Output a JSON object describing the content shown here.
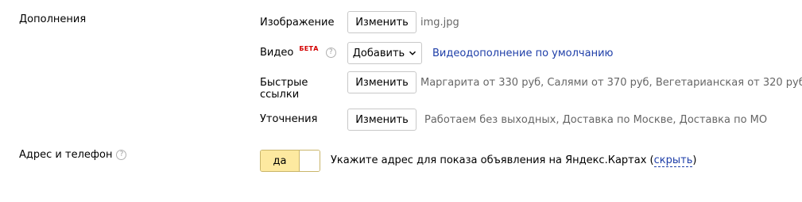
{
  "sections": {
    "extras_title": "Дополнения",
    "address_title": "Адрес и телефон",
    "address_help_icon": "question-circle-icon"
  },
  "image_row": {
    "label": "Изображение",
    "button": "Изменить",
    "value": "img.jpg"
  },
  "video_row": {
    "label": "Видео",
    "badge": "БЕТА",
    "help_icon": "question-circle-icon",
    "button": "Добавить",
    "button_icon": "chevron-down-icon",
    "link": "Видеодополнение по умолчанию"
  },
  "quick_links_row": {
    "label_line1": "Быстрые",
    "label_line2": "ссылки",
    "button": "Изменить",
    "value": "Маргарита от 330 руб, Салями от 370 руб, Вегетарианская от 320 руб"
  },
  "clarifications_row": {
    "label": "Уточнения",
    "button": "Изменить",
    "value": "Работаем без выходных, Доставка по Москве, Доставка по МО"
  },
  "address_row": {
    "toggle_label": "да",
    "text": "Укажите адрес для показа объявления на Яндекс.Картах (",
    "link": "скрыть",
    "text_end": ")"
  },
  "colors": {
    "link": "#1e3ea8",
    "beta": "#d40000",
    "toggle_on": "#fde9a0",
    "secondary_text": "#666666"
  }
}
